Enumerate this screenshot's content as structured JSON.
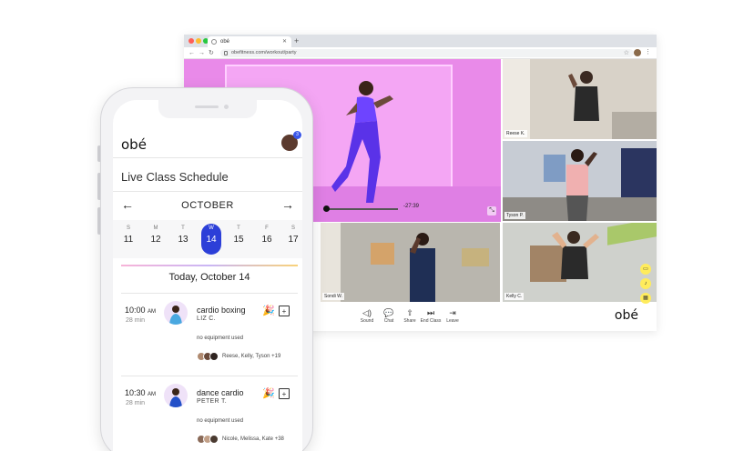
{
  "browser": {
    "tab_title": "obé",
    "url": "obefitness.com/workout/party",
    "controls": [
      {
        "icon": "sound-icon",
        "glyph": "◁)",
        "label": "Sound"
      },
      {
        "icon": "chat-icon",
        "glyph": "💬",
        "label": "Chat"
      },
      {
        "icon": "share-icon",
        "glyph": "⇧",
        "label": "Share"
      },
      {
        "icon": "end-class-icon",
        "glyph": "⏭",
        "label": "End Class"
      },
      {
        "icon": "leave-icon",
        "glyph": "⇥",
        "label": "Leave"
      }
    ],
    "logo": "obé",
    "video": {
      "time_remaining": "-27:39"
    },
    "participants": [
      {
        "name": "Reese K."
      },
      {
        "name": "Tyson P."
      },
      {
        "name": "Sondi W."
      },
      {
        "name": "Kelly C."
      }
    ]
  },
  "app": {
    "logo": "obé",
    "notification_count": "3",
    "schedule_title": "Live Class Schedule",
    "month": "OCTOBER",
    "prev_arrow": "←",
    "next_arrow": "→",
    "days": [
      {
        "letter": "S",
        "num": "11"
      },
      {
        "letter": "M",
        "num": "12"
      },
      {
        "letter": "T",
        "num": "13"
      },
      {
        "letter": "W",
        "num": "14"
      },
      {
        "letter": "T",
        "num": "15"
      },
      {
        "letter": "F",
        "num": "16"
      },
      {
        "letter": "S",
        "num": "17"
      }
    ],
    "selected_day": "14",
    "today_label": "Today, October 14",
    "classes": [
      {
        "time": "10:00",
        "ampm": "AM",
        "duration": "28 min",
        "title": "cardio boxing",
        "instructor": "LIZ C.",
        "equipment": "no equipment used",
        "attendees": "Reese, Kelly, Tyson +19"
      },
      {
        "time": "10:30",
        "ampm": "AM",
        "duration": "28 min",
        "title": "dance cardio",
        "instructor": "PETER T.",
        "equipment": "no equipment used",
        "attendees": "Nicole, Melissa, Kate +38"
      }
    ]
  }
}
